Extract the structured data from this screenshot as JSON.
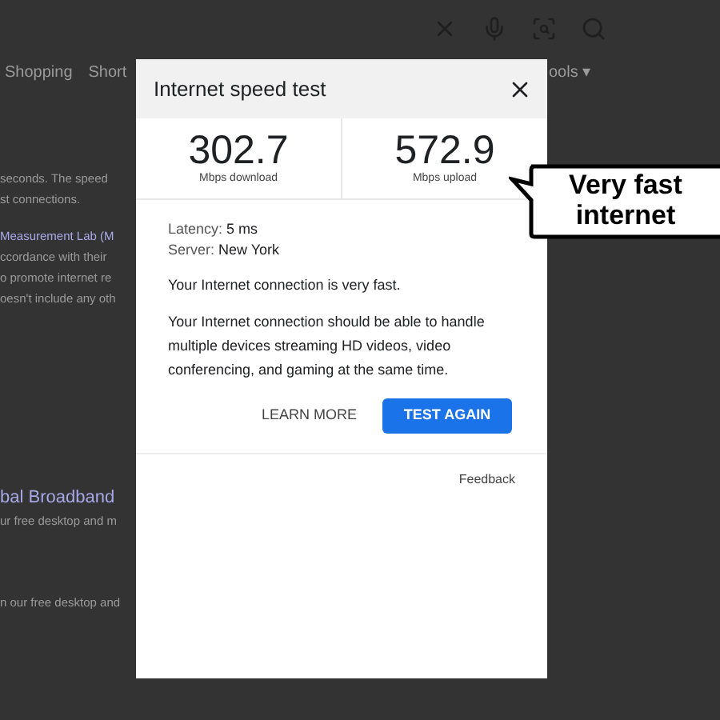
{
  "background": {
    "tabs": [
      "Shopping",
      "Short"
    ],
    "tools": "ools ▾",
    "lines": [
      {
        "kind": "text",
        "text": "seconds. The speed"
      },
      {
        "kind": "text",
        "text": "st connections."
      },
      {
        "kind": "link",
        "text": "Measurement Lab (M"
      },
      {
        "kind": "text",
        "text": "ccordance with their"
      },
      {
        "kind": "text",
        "text": "o promote internet re"
      },
      {
        "kind": "text",
        "text": "oesn't include any oth"
      }
    ],
    "result_title": "bal Broadband",
    "result_snippet": "ur free desktop and m",
    "result_snippet_2": "n our free desktop and"
  },
  "dialog": {
    "title": "Internet speed test",
    "stats": [
      {
        "value": "302.7",
        "label": "Mbps download"
      },
      {
        "value": "572.9",
        "label": "Mbps upload"
      }
    ],
    "latency_label": "Latency:",
    "latency": "5 ms",
    "server_label": "Server:",
    "server": "New York",
    "summary": "Your Internet connection is very fast.",
    "detail": "Your Internet connection should be able to handle multiple devices streaming HD videos, video conferencing, and gaming at the same time.",
    "buttons": [
      {
        "kind": "text",
        "label": "LEARN MORE"
      },
      {
        "kind": "primary",
        "label": "TEST AGAIN"
      }
    ],
    "feedback": "Feedback"
  },
  "callout": "Very fast internet"
}
